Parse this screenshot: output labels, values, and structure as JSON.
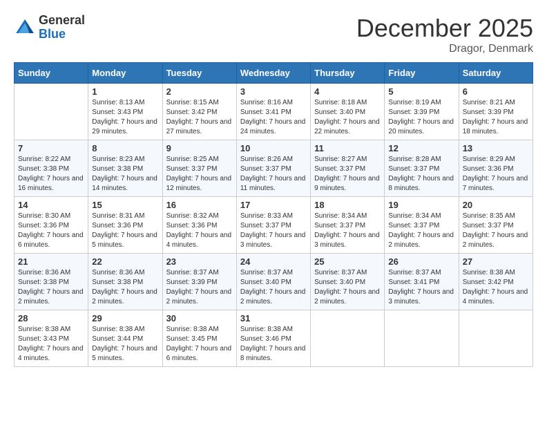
{
  "header": {
    "logo_general": "General",
    "logo_blue": "Blue",
    "month": "December 2025",
    "location": "Dragor, Denmark"
  },
  "days_of_week": [
    "Sunday",
    "Monday",
    "Tuesday",
    "Wednesday",
    "Thursday",
    "Friday",
    "Saturday"
  ],
  "weeks": [
    [
      {
        "day": "",
        "sunrise": "",
        "sunset": "",
        "daylight": ""
      },
      {
        "day": "1",
        "sunrise": "Sunrise: 8:13 AM",
        "sunset": "Sunset: 3:43 PM",
        "daylight": "Daylight: 7 hours and 29 minutes."
      },
      {
        "day": "2",
        "sunrise": "Sunrise: 8:15 AM",
        "sunset": "Sunset: 3:42 PM",
        "daylight": "Daylight: 7 hours and 27 minutes."
      },
      {
        "day": "3",
        "sunrise": "Sunrise: 8:16 AM",
        "sunset": "Sunset: 3:41 PM",
        "daylight": "Daylight: 7 hours and 24 minutes."
      },
      {
        "day": "4",
        "sunrise": "Sunrise: 8:18 AM",
        "sunset": "Sunset: 3:40 PM",
        "daylight": "Daylight: 7 hours and 22 minutes."
      },
      {
        "day": "5",
        "sunrise": "Sunrise: 8:19 AM",
        "sunset": "Sunset: 3:39 PM",
        "daylight": "Daylight: 7 hours and 20 minutes."
      },
      {
        "day": "6",
        "sunrise": "Sunrise: 8:21 AM",
        "sunset": "Sunset: 3:39 PM",
        "daylight": "Daylight: 7 hours and 18 minutes."
      }
    ],
    [
      {
        "day": "7",
        "sunrise": "Sunrise: 8:22 AM",
        "sunset": "Sunset: 3:38 PM",
        "daylight": "Daylight: 7 hours and 16 minutes."
      },
      {
        "day": "8",
        "sunrise": "Sunrise: 8:23 AM",
        "sunset": "Sunset: 3:38 PM",
        "daylight": "Daylight: 7 hours and 14 minutes."
      },
      {
        "day": "9",
        "sunrise": "Sunrise: 8:25 AM",
        "sunset": "Sunset: 3:37 PM",
        "daylight": "Daylight: 7 hours and 12 minutes."
      },
      {
        "day": "10",
        "sunrise": "Sunrise: 8:26 AM",
        "sunset": "Sunset: 3:37 PM",
        "daylight": "Daylight: 7 hours and 11 minutes."
      },
      {
        "day": "11",
        "sunrise": "Sunrise: 8:27 AM",
        "sunset": "Sunset: 3:37 PM",
        "daylight": "Daylight: 7 hours and 9 minutes."
      },
      {
        "day": "12",
        "sunrise": "Sunrise: 8:28 AM",
        "sunset": "Sunset: 3:37 PM",
        "daylight": "Daylight: 7 hours and 8 minutes."
      },
      {
        "day": "13",
        "sunrise": "Sunrise: 8:29 AM",
        "sunset": "Sunset: 3:36 PM",
        "daylight": "Daylight: 7 hours and 7 minutes."
      }
    ],
    [
      {
        "day": "14",
        "sunrise": "Sunrise: 8:30 AM",
        "sunset": "Sunset: 3:36 PM",
        "daylight": "Daylight: 7 hours and 6 minutes."
      },
      {
        "day": "15",
        "sunrise": "Sunrise: 8:31 AM",
        "sunset": "Sunset: 3:36 PM",
        "daylight": "Daylight: 7 hours and 5 minutes."
      },
      {
        "day": "16",
        "sunrise": "Sunrise: 8:32 AM",
        "sunset": "Sunset: 3:36 PM",
        "daylight": "Daylight: 7 hours and 4 minutes."
      },
      {
        "day": "17",
        "sunrise": "Sunrise: 8:33 AM",
        "sunset": "Sunset: 3:37 PM",
        "daylight": "Daylight: 7 hours and 3 minutes."
      },
      {
        "day": "18",
        "sunrise": "Sunrise: 8:34 AM",
        "sunset": "Sunset: 3:37 PM",
        "daylight": "Daylight: 7 hours and 3 minutes."
      },
      {
        "day": "19",
        "sunrise": "Sunrise: 8:34 AM",
        "sunset": "Sunset: 3:37 PM",
        "daylight": "Daylight: 7 hours and 2 minutes."
      },
      {
        "day": "20",
        "sunrise": "Sunrise: 8:35 AM",
        "sunset": "Sunset: 3:37 PM",
        "daylight": "Daylight: 7 hours and 2 minutes."
      }
    ],
    [
      {
        "day": "21",
        "sunrise": "Sunrise: 8:36 AM",
        "sunset": "Sunset: 3:38 PM",
        "daylight": "Daylight: 7 hours and 2 minutes."
      },
      {
        "day": "22",
        "sunrise": "Sunrise: 8:36 AM",
        "sunset": "Sunset: 3:38 PM",
        "daylight": "Daylight: 7 hours and 2 minutes."
      },
      {
        "day": "23",
        "sunrise": "Sunrise: 8:37 AM",
        "sunset": "Sunset: 3:39 PM",
        "daylight": "Daylight: 7 hours and 2 minutes."
      },
      {
        "day": "24",
        "sunrise": "Sunrise: 8:37 AM",
        "sunset": "Sunset: 3:40 PM",
        "daylight": "Daylight: 7 hours and 2 minutes."
      },
      {
        "day": "25",
        "sunrise": "Sunrise: 8:37 AM",
        "sunset": "Sunset: 3:40 PM",
        "daylight": "Daylight: 7 hours and 2 minutes."
      },
      {
        "day": "26",
        "sunrise": "Sunrise: 8:37 AM",
        "sunset": "Sunset: 3:41 PM",
        "daylight": "Daylight: 7 hours and 3 minutes."
      },
      {
        "day": "27",
        "sunrise": "Sunrise: 8:38 AM",
        "sunset": "Sunset: 3:42 PM",
        "daylight": "Daylight: 7 hours and 4 minutes."
      }
    ],
    [
      {
        "day": "28",
        "sunrise": "Sunrise: 8:38 AM",
        "sunset": "Sunset: 3:43 PM",
        "daylight": "Daylight: 7 hours and 4 minutes."
      },
      {
        "day": "29",
        "sunrise": "Sunrise: 8:38 AM",
        "sunset": "Sunset: 3:44 PM",
        "daylight": "Daylight: 7 hours and 5 minutes."
      },
      {
        "day": "30",
        "sunrise": "Sunrise: 8:38 AM",
        "sunset": "Sunset: 3:45 PM",
        "daylight": "Daylight: 7 hours and 6 minutes."
      },
      {
        "day": "31",
        "sunrise": "Sunrise: 8:38 AM",
        "sunset": "Sunset: 3:46 PM",
        "daylight": "Daylight: 7 hours and 8 minutes."
      },
      {
        "day": "",
        "sunrise": "",
        "sunset": "",
        "daylight": ""
      },
      {
        "day": "",
        "sunrise": "",
        "sunset": "",
        "daylight": ""
      },
      {
        "day": "",
        "sunrise": "",
        "sunset": "",
        "daylight": ""
      }
    ]
  ]
}
